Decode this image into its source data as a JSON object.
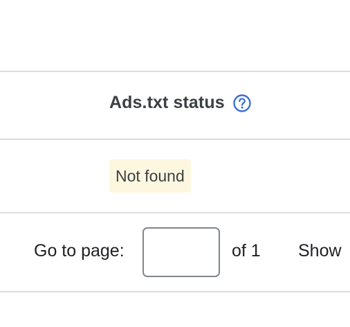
{
  "table": {
    "columns": [
      {
        "label": "Ads.txt status",
        "help_icon": "help-circle-icon"
      }
    ],
    "rows": [
      {
        "ads_txt_status": "Not found",
        "status_color": "#fef7e0"
      }
    ]
  },
  "pagination": {
    "go_to_page_label": "Go to page:",
    "page_input_value": "",
    "of_label": "of 1",
    "show_label": "Show"
  },
  "colors": {
    "divider": "#dadce0",
    "help_icon": "#3c6fd6",
    "badge_background": "#fef7e0"
  }
}
